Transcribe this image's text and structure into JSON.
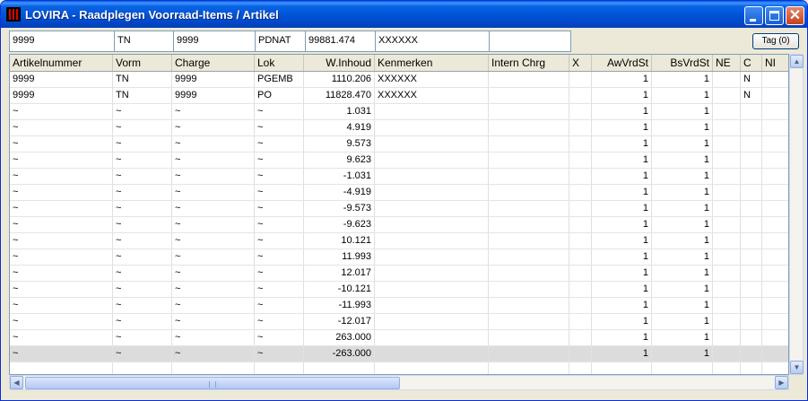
{
  "window": {
    "title": "LOVIRA - Raadplegen Voorraad-Items / Artikel"
  },
  "filter": {
    "fields": [
      {
        "value": "9999"
      },
      {
        "value": "TN"
      },
      {
        "value": "9999"
      },
      {
        "value": "PDNAT"
      },
      {
        "value": "99881.474"
      },
      {
        "value": "XXXXXX"
      },
      {
        "value": ""
      }
    ],
    "tag_button": "Tag (0)"
  },
  "grid": {
    "columns": [
      "Artikelnummer",
      "Vorm",
      "Charge",
      "Lok",
      "W.Inhoud",
      "Kenmerken",
      "Intern Chrg",
      "X",
      "AwVrdSt",
      "BsVrdSt",
      "NE",
      "C",
      "NI"
    ],
    "rows": [
      [
        "9999",
        "TN",
        "9999",
        "PGEMB",
        "1110.206",
        "XXXXXX",
        "",
        "",
        "1",
        "1",
        "",
        "N",
        ""
      ],
      [
        "9999",
        "TN",
        "9999",
        "PO",
        "11828.470",
        "XXXXXX",
        "",
        "",
        "1",
        "1",
        "",
        "N",
        ""
      ],
      [
        "~",
        "~",
        "~",
        "~",
        "1.031",
        "",
        "",
        "",
        "1",
        "1",
        "",
        "",
        ""
      ],
      [
        "~",
        "~",
        "~",
        "~",
        "4.919",
        "",
        "",
        "",
        "1",
        "1",
        "",
        "",
        ""
      ],
      [
        "~",
        "~",
        "~",
        "~",
        "9.573",
        "",
        "",
        "",
        "1",
        "1",
        "",
        "",
        ""
      ],
      [
        "~",
        "~",
        "~",
        "~",
        "9.623",
        "",
        "",
        "",
        "1",
        "1",
        "",
        "",
        ""
      ],
      [
        "~",
        "~",
        "~",
        "~",
        "-1.031",
        "",
        "",
        "",
        "1",
        "1",
        "",
        "",
        ""
      ],
      [
        "~",
        "~",
        "~",
        "~",
        "-4.919",
        "",
        "",
        "",
        "1",
        "1",
        "",
        "",
        ""
      ],
      [
        "~",
        "~",
        "~",
        "~",
        "-9.573",
        "",
        "",
        "",
        "1",
        "1",
        "",
        "",
        ""
      ],
      [
        "~",
        "~",
        "~",
        "~",
        "-9.623",
        "",
        "",
        "",
        "1",
        "1",
        "",
        "",
        ""
      ],
      [
        "~",
        "~",
        "~",
        "~",
        "10.121",
        "",
        "",
        "",
        "1",
        "1",
        "",
        "",
        ""
      ],
      [
        "~",
        "~",
        "~",
        "~",
        "11.993",
        "",
        "",
        "",
        "1",
        "1",
        "",
        "",
        ""
      ],
      [
        "~",
        "~",
        "~",
        "~",
        "12.017",
        "",
        "",
        "",
        "1",
        "1",
        "",
        "",
        ""
      ],
      [
        "~",
        "~",
        "~",
        "~",
        "-10.121",
        "",
        "",
        "",
        "1",
        "1",
        "",
        "",
        ""
      ],
      [
        "~",
        "~",
        "~",
        "~",
        "-11.993",
        "",
        "",
        "",
        "1",
        "1",
        "",
        "",
        ""
      ],
      [
        "~",
        "~",
        "~",
        "~",
        "-12.017",
        "",
        "",
        "",
        "1",
        "1",
        "",
        "",
        ""
      ],
      [
        "~",
        "~",
        "~",
        "~",
        "263.000",
        "",
        "",
        "",
        "1",
        "1",
        "",
        "",
        ""
      ],
      [
        "~",
        "~",
        "~",
        "~",
        "-263.000",
        "",
        "",
        "",
        "1",
        "1",
        "",
        "",
        ""
      ],
      [
        "",
        "",
        "",
        "",
        "",
        "",
        "",
        "",
        "",
        "",
        "",
        "",
        ""
      ]
    ],
    "selected_row": 17
  },
  "icons": {
    "app": "app-icon",
    "minimize": "minimize-icon",
    "maximize": "maximize-icon",
    "close": "close-icon",
    "scroll_up": "scroll-up-icon",
    "scroll_down": "scroll-down-icon",
    "scroll_left": "scroll-left-icon",
    "scroll_right": "scroll-right-icon"
  },
  "colors": {
    "titlebar": "#0a5fe0",
    "window_bg": "#ece9d8",
    "selected_row": "#dcdcdc"
  }
}
